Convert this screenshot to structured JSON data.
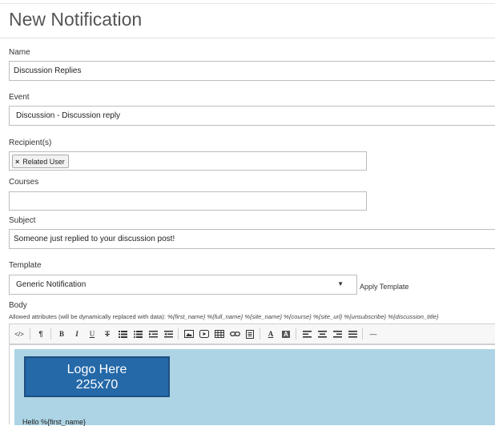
{
  "page": {
    "title": "New Notification"
  },
  "form": {
    "name": {
      "label": "Name",
      "value": "Discussion Replies"
    },
    "event": {
      "label": "Event",
      "value": "Discussion - Discussion reply"
    },
    "recipients": {
      "label": "Recipient(s)",
      "tags": [
        "Related User"
      ],
      "remove_glyph": "×"
    },
    "courses": {
      "label": "Courses",
      "value": ""
    },
    "subject": {
      "label": "Subject",
      "value": "Someone just replied to your discussion post!"
    },
    "template": {
      "label": "Template",
      "value": "Generic Notification",
      "apply_label": "Apply Template"
    },
    "body": {
      "label": "Body",
      "allowed_prefix": "Allowed attributes (will be dynamically replaced with data):",
      "allowed_attrs": "%{first_name} %{full_name} %{site_name} %{course} %{site_url} %{unsubscribe} %{discussion_title}"
    }
  },
  "toolbar": {
    "icons": [
      "code-view-icon",
      "paragraph-icon",
      "bold-icon",
      "italic-icon",
      "underline-icon",
      "strikethrough-icon",
      "unordered-list-icon",
      "ordered-list-icon",
      "outdent-icon",
      "indent-icon",
      "image-icon",
      "video-icon",
      "table-icon",
      "link-icon",
      "file-icon",
      "font-color-icon",
      "background-color-icon",
      "align-left-icon",
      "align-center-icon",
      "align-right-icon",
      "justify-icon",
      "horizontal-rule-icon"
    ],
    "glyphs": {
      "code": "</>",
      "paragraph": "¶",
      "bold": "B",
      "italic": "I",
      "underline": "U",
      "strike": "T",
      "font_color": "A",
      "bg_color": "A",
      "hr": "—"
    }
  },
  "editor": {
    "logo_line1": "Logo Here",
    "logo_line2": "225x70",
    "hello": "Hello %{first_name}",
    "background_color": "#acd4e4",
    "logo_color": "#2569a8"
  }
}
